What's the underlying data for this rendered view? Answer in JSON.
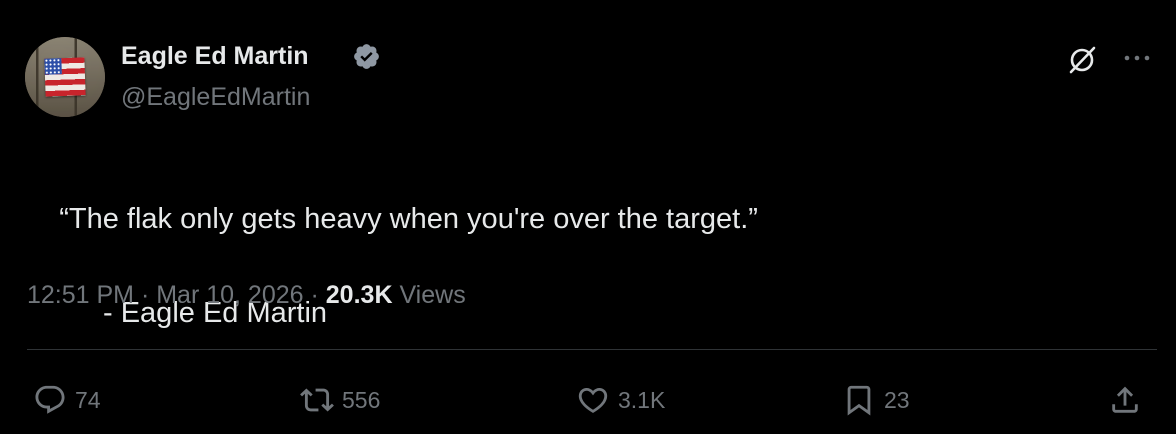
{
  "author": {
    "name": "Eagle Ed Martin",
    "handle": "@EagleEdMartin",
    "verified": true,
    "verified_color": "#8f98a3"
  },
  "tweet": {
    "line1": "“The flak only gets heavy when you're over the target.”",
    "line2": "- Eagle Ed Martin"
  },
  "meta": {
    "time": "12:51 PM",
    "separator": " · ",
    "date": "Mar 10, 2026",
    "views_count": "20.3K",
    "views_label": "Views"
  },
  "actions": {
    "reply_count": "74",
    "repost_count": "556",
    "like_count": "3.1K",
    "bookmark_count": "23"
  },
  "icons": {
    "grok": "grok-icon",
    "more": "more-icon",
    "reply": "reply-icon",
    "repost": "repost-icon",
    "like": "heart-icon",
    "bookmark": "bookmark-icon",
    "share": "share-icon"
  },
  "colors": {
    "background": "#000000",
    "text_primary": "#e7e9ea",
    "text_secondary": "#71767b",
    "divider": "#2f3336"
  }
}
